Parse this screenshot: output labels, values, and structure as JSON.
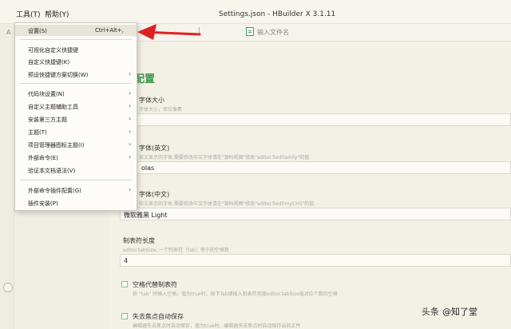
{
  "menubar": {
    "menus": [
      {
        "label": "工具(T)"
      },
      {
        "label": "帮助(Y)"
      }
    ],
    "window_title": "Settings.json - HBuilder X 3.1.11"
  },
  "left_strip": {
    "glyph_a": "A",
    "glyph_b": "<"
  },
  "editor": {
    "tab_cursor": "|",
    "search_placeholder": "输入文件名"
  },
  "settings": {
    "heading": "配置",
    "items": [
      {
        "label": "字体大小",
        "desc": "字体大小，单位像素",
        "value": ""
      },
      {
        "label": "字体(英文)",
        "desc": "英文显示的字体,需要修改中文字体请在\"源码视图\"修改\"editor.fontFamily\"的值",
        "value": "olas"
      },
      {
        "label": "字体(中文)",
        "desc": "中文显示的字体,需要修改中文字体请在\"源码视图\"修改\"editor.fontFmyCHS\"的值",
        "value": "微软雅黑 Light"
      },
      {
        "label": "制表符长度",
        "desc": "editor.tabSize, 一个制表符（tab）等于的空格数",
        "value": "4"
      }
    ],
    "checkbox_items": [
      {
        "label": "空格代替制表符",
        "desc": "按 \"tab\" 时插入空格。值为true时，按下Tab键插入制表符宽度editor.tabSize值对应个数的空格"
      },
      {
        "label": "失去焦点自动保存",
        "desc": "编辑器失去焦点时自动保存，值为true时，编辑器失去焦点时自动保存当前文件"
      }
    ]
  },
  "menu": {
    "items": [
      {
        "label": "设置(S)",
        "shortcut": "Ctrl+Alt+,",
        "submenu": false
      },
      {
        "label": "可视化自定义快捷键",
        "shortcut": "",
        "submenu": false
      },
      {
        "label": "自定义快捷键(K)",
        "shortcut": "",
        "submenu": false
      },
      {
        "label": "预设快捷键方案切换(W)",
        "shortcut": "",
        "submenu": true
      },
      {
        "label": "代码块设置(N)",
        "shortcut": "",
        "submenu": true
      },
      {
        "label": "自定义主题辅助工具",
        "shortcut": "",
        "submenu": true
      },
      {
        "label": "安装第三方主题",
        "shortcut": "",
        "submenu": true
      },
      {
        "label": "主题(T)",
        "shortcut": "",
        "submenu": true
      },
      {
        "label": "项目管理器图标主题(I)",
        "shortcut": "",
        "submenu": true
      },
      {
        "label": "外部命令(E)",
        "shortcut": "",
        "submenu": true
      },
      {
        "label": "验证本文档语法(V)",
        "shortcut": "",
        "submenu": false
      },
      {
        "label": "外部命令插件配置(G)",
        "shortcut": "",
        "submenu": true
      },
      {
        "label": "插件安装(P)",
        "shortcut": "",
        "submenu": false
      }
    ]
  },
  "watermark": {
    "prefix": "头条",
    "handle": "@知了堂"
  },
  "colors": {
    "accent_green": "#3f9a4a",
    "annotation_red": "#e02020",
    "menu_highlight": "#e8e4d8"
  }
}
